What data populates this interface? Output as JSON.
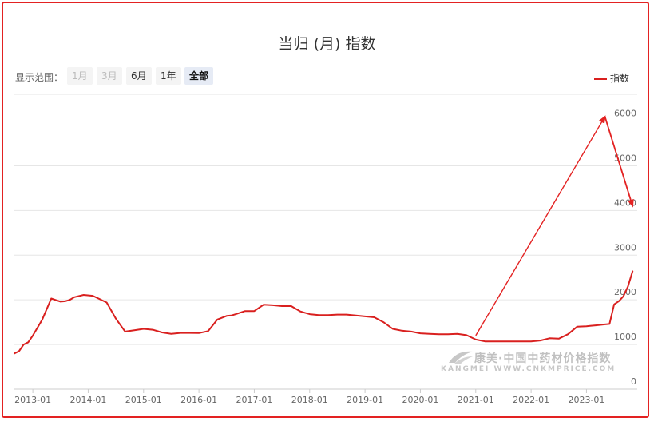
{
  "title": "当归 (月) 指数",
  "range_selector": {
    "label": "显示范围：",
    "buttons": [
      "1月",
      "3月",
      "6月",
      "1年",
      "全部"
    ],
    "active": "全部"
  },
  "watermark": {
    "cn": "康美·中国中药材价格指数",
    "en": "KANGMEI WWW.CNKMPRICE.COM"
  },
  "colors": {
    "series": "#d9201f",
    "frame": "#e32222",
    "arrow": "#e32222"
  },
  "chart_data": {
    "type": "line",
    "title": "当归 (月) 指数",
    "xlabel": "",
    "ylabel": "",
    "legend": {
      "entries": [
        "指数"
      ],
      "position": "top-right"
    },
    "grid": true,
    "x_ticks": [
      "2013-01",
      "2014-01",
      "2015-01",
      "2016-01",
      "2017-01",
      "2018-01",
      "2019-01",
      "2020-01",
      "2021-01",
      "2022-01",
      "2023-01"
    ],
    "y_ticks": [
      0,
      1000,
      2000,
      3000,
      4000,
      5000,
      6000
    ],
    "ylim": [
      0,
      6600
    ],
    "xlim": [
      "2012-09",
      "2023-12"
    ],
    "y_axis_position": "right",
    "series": [
      {
        "name": "指数",
        "x": [
          "2012-09",
          "2012-10",
          "2012-11",
          "2012-12",
          "2013-01",
          "2013-03",
          "2013-05",
          "2013-07",
          "2013-08",
          "2013-09",
          "2013-10",
          "2013-12",
          "2014-02",
          "2014-03",
          "2014-05",
          "2014-07",
          "2014-09",
          "2014-11",
          "2015-01",
          "2015-03",
          "2015-05",
          "2015-07",
          "2015-09",
          "2015-11",
          "2016-01",
          "2016-03",
          "2016-05",
          "2016-07",
          "2016-08",
          "2016-09",
          "2016-11",
          "2017-01",
          "2017-03",
          "2017-05",
          "2017-07",
          "2017-09",
          "2017-11",
          "2018-01",
          "2018-03",
          "2018-05",
          "2018-07",
          "2018-09",
          "2018-11",
          "2019-01",
          "2019-03",
          "2019-05",
          "2019-07",
          "2019-09",
          "2019-11",
          "2020-01",
          "2020-03",
          "2020-05",
          "2020-07",
          "2020-09",
          "2020-11",
          "2021-01",
          "2021-03",
          "2021-05",
          "2021-07",
          "2021-09",
          "2021-11",
          "2022-01",
          "2022-03",
          "2022-05",
          "2022-07",
          "2022-09",
          "2022-11",
          "2023-01",
          "2023-02",
          "2023-03",
          "2023-04",
          "2023-05",
          "2023-06",
          "2023-07",
          "2023-08",
          "2023-09",
          "2023-10",
          "2023-11"
        ],
        "values": [
          800,
          850,
          1000,
          1050,
          1200,
          1550,
          2030,
          1960,
          1970,
          2000,
          2060,
          2110,
          2090,
          2040,
          1940,
          1580,
          1290,
          1320,
          1350,
          1330,
          1270,
          1240,
          1260,
          1260,
          1255,
          1300,
          1560,
          1640,
          1650,
          1680,
          1750,
          1750,
          1890,
          1880,
          1860,
          1860,
          1740,
          1680,
          1660,
          1660,
          1670,
          1670,
          1650,
          1630,
          1610,
          1500,
          1350,
          1310,
          1290,
          1250,
          1240,
          1230,
          1230,
          1240,
          1210,
          1110,
          1070,
          1070,
          1070,
          1070,
          1070,
          1070,
          1090,
          1140,
          1130,
          1230,
          1400,
          1410,
          1420,
          1430,
          1440,
          1450,
          1460,
          1900,
          1970,
          2080,
          2300,
          2640
        ]
      }
    ],
    "annotations": [
      {
        "type": "arrow",
        "from": [
          "2021-01",
          1200
        ],
        "to": [
          "2023-05",
          6100
        ]
      },
      {
        "type": "arrow",
        "from": [
          "2023-05",
          6100
        ],
        "to": [
          "2023-11",
          4100
        ]
      }
    ]
  }
}
